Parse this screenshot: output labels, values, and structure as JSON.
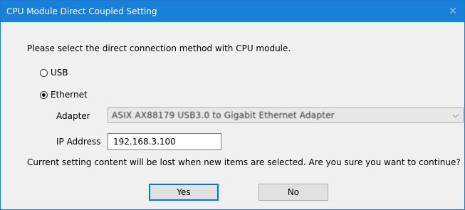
{
  "window": {
    "title": "CPU Module Direct Coupled Setting",
    "close_glyph": "✕"
  },
  "prompt": "Please select the direct connection method with CPU module.",
  "connection": {
    "options": [
      {
        "label": "USB",
        "selected": false
      },
      {
        "label": "Ethernet",
        "selected": true
      }
    ]
  },
  "adapter": {
    "label": "Adapter",
    "value": "ASIX AX88179 USB3.0 to Gigabit Ethernet Adapter",
    "arrow_icon": "chevron-down-icon"
  },
  "ip": {
    "label": "IP Address",
    "value": "192.168.3.100"
  },
  "warning": "Current setting content will be lost when new items are selected. Are you sure you want to continue?",
  "buttons": {
    "yes": "Yes",
    "no": "No"
  },
  "colors": {
    "titlebar": "#1a7fd8",
    "focus": "#0078d7"
  }
}
